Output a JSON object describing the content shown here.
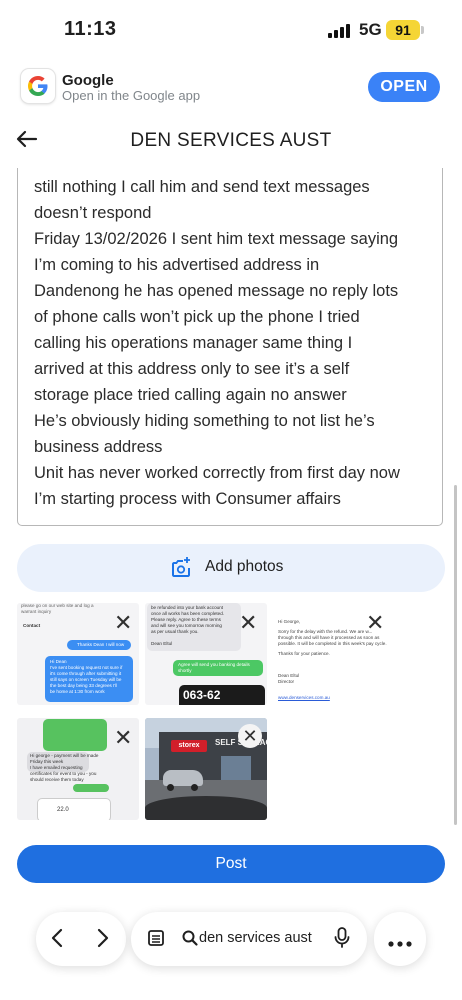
{
  "status_bar": {
    "time": "11:13",
    "network": "5G",
    "battery": "91"
  },
  "google_banner": {
    "app_name": "Google",
    "subtitle": "Open in the Google app",
    "open_label": "OPEN"
  },
  "header": {
    "title": "DEN SERVICES AUST"
  },
  "review_text": {
    "lines": [
      "still nothing I call him and send text messages",
      "doesn’t respond",
      "Friday 13/02/2026 I sent him text message saying",
      "I’m coming to his advertised address in",
      "Dandenong he has opened message no reply lots",
      "of phone calls won’t pick up the phone I tried",
      "calling his operations manager same thing I",
      "arrived at this address only to see it’s a self",
      "storage place tried calling again no answer",
      "He’s obviously hiding something to not list he’s",
      "business address",
      "Unit has never worked correctly from first day now",
      "I’m starting process with Consumer affairs"
    ]
  },
  "add_photos": {
    "label": "Add photos"
  },
  "photos": {
    "p1": {
      "t1": "please go on our web site and log a",
      "t2": "warrant inquiry",
      "t3": "Contact",
      "t4": "Thanks Dean I will now",
      "t5": "Hi Dean",
      "t6": "I've sent booking request not sure if",
      "t7": "it's come through after submitting it",
      "t8": "still says on screen Tuesday will be",
      "t9": "the best day being 33 degrees I'll",
      "t10": "be home at 1:30 from work"
    },
    "p2": {
      "t1": "be refunded into your bank account",
      "t2": "once all works has been completed.",
      "t3": "Please reply. Agree to these terms",
      "t4": "and will see you tomorrow morning",
      "t5": "as per usual thank you.",
      "t6": "Dean Eltul",
      "t7": "Agree will send you banking details",
      "t8": "shortly",
      "t9": "063-62"
    },
    "p3": {
      "t1": "Hi George,",
      "t2": "Sorry for the delay with the refund. We are w...",
      "t3": "through this and will have it processed as soon as",
      "t4": "possible. It will be completed in this week's pay cycle.",
      "t5": "Thanks for your patience.",
      "t6": "Dean Eltul",
      "t7": "Director",
      "t8": "www.denservices.com.au"
    },
    "p4": {
      "t1": "Hi george - payment will be made",
      "t2": "Friday this week",
      "t3": "I have emailed requesting",
      "t4": "certificates for event to you - you",
      "t5": "should receive them today",
      "t6": "22.0"
    },
    "p5": {
      "sign": "SELF STORAGE",
      "brand": "storex"
    }
  },
  "post_button": {
    "label": "Post"
  },
  "bottom_bar": {
    "search_query": "den services aust"
  }
}
